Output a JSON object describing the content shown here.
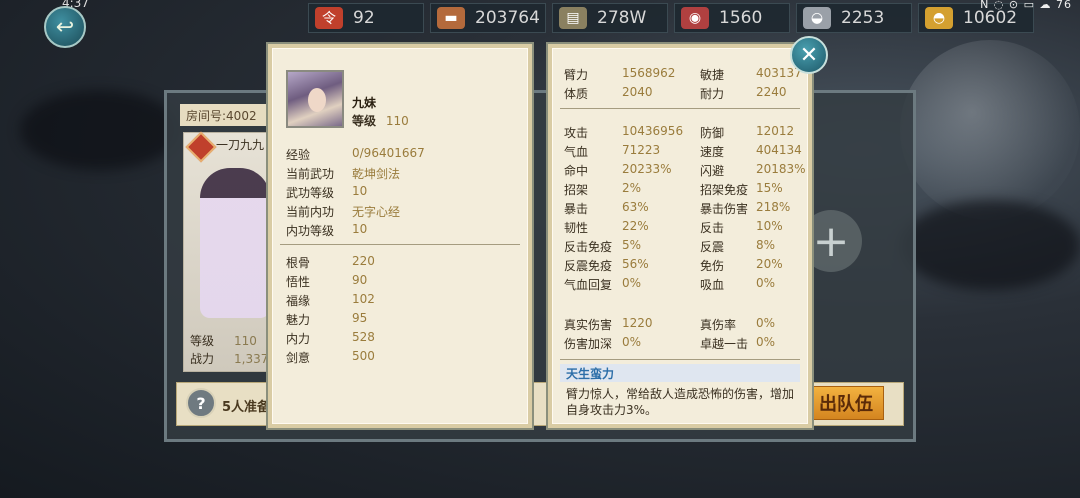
{
  "status_time": "4:37",
  "system_icons": "N ◌ ⊙ ▭ ☁ 76",
  "resources": [
    {
      "icon": "token-icon",
      "value": "92",
      "color": "#c0402c"
    },
    {
      "icon": "wood-icon",
      "value": "203764",
      "color": "#b46a3c"
    },
    {
      "icon": "book-icon",
      "value": "278W",
      "color": "#8a8060"
    },
    {
      "icon": "meat-icon",
      "value": "1560",
      "color": "#b04040"
    },
    {
      "icon": "silver-icon",
      "value": "2253",
      "color": "#9aa0a8"
    },
    {
      "icon": "gold-ingot-icon",
      "value": "10602",
      "color": "#d4a030"
    }
  ],
  "team": {
    "room_label": "房间号:4002",
    "member_title": "一刀九九",
    "stats": [
      {
        "label": "等级",
        "value": "110"
      },
      {
        "label": "战力",
        "value": "1,337"
      }
    ],
    "ready_text": "5人准备",
    "leave_label": "出队伍"
  },
  "character": {
    "name": "九妹",
    "level_label": "等级",
    "level": "110",
    "info": [
      {
        "label": "经验",
        "value": "0/96401667"
      },
      {
        "label": "当前武功",
        "value": "乾坤剑法"
      },
      {
        "label": "武功等级",
        "value": "10"
      },
      {
        "label": "当前内功",
        "value": "无字心经"
      },
      {
        "label": "内功等级",
        "value": "10"
      }
    ],
    "attributes": [
      {
        "label": "根骨",
        "value": "220"
      },
      {
        "label": "悟性",
        "value": "90"
      },
      {
        "label": "福缘",
        "value": "102"
      },
      {
        "label": "魅力",
        "value": "95"
      },
      {
        "label": "内力",
        "value": "528"
      },
      {
        "label": "剑意",
        "value": "500"
      }
    ]
  },
  "combat": {
    "base": [
      [
        "臂力",
        "1568962",
        "敏捷",
        "403137"
      ],
      [
        "体质",
        "2040",
        "耐力",
        "2240"
      ]
    ],
    "stats": [
      [
        "攻击",
        "10436956",
        "防御",
        "12012"
      ],
      [
        "气血",
        "71223",
        "速度",
        "404134"
      ],
      [
        "命中",
        "20233%",
        "闪避",
        "20183%"
      ],
      [
        "招架",
        "2%",
        "招架免疫",
        "15%"
      ],
      [
        "暴击",
        "63%",
        "暴击伤害",
        "218%"
      ],
      [
        "韧性",
        "22%",
        "反击",
        "10%"
      ],
      [
        "反击免疫",
        "5%",
        "反震",
        "8%"
      ],
      [
        "反震免疫",
        "56%",
        "免伤",
        "20%"
      ],
      [
        "气血回复",
        "0%",
        "吸血",
        "0%"
      ]
    ],
    "extra": [
      [
        "真实伤害",
        "1220",
        "真伤率",
        "0%"
      ],
      [
        "伤害加深",
        "0%",
        "卓越一击",
        "0%"
      ]
    ],
    "talent_title": "天生蛮力",
    "talent_desc": "臂力惊人，常给敌人造成恐怖的伤害，增加自身攻击力3%。"
  }
}
